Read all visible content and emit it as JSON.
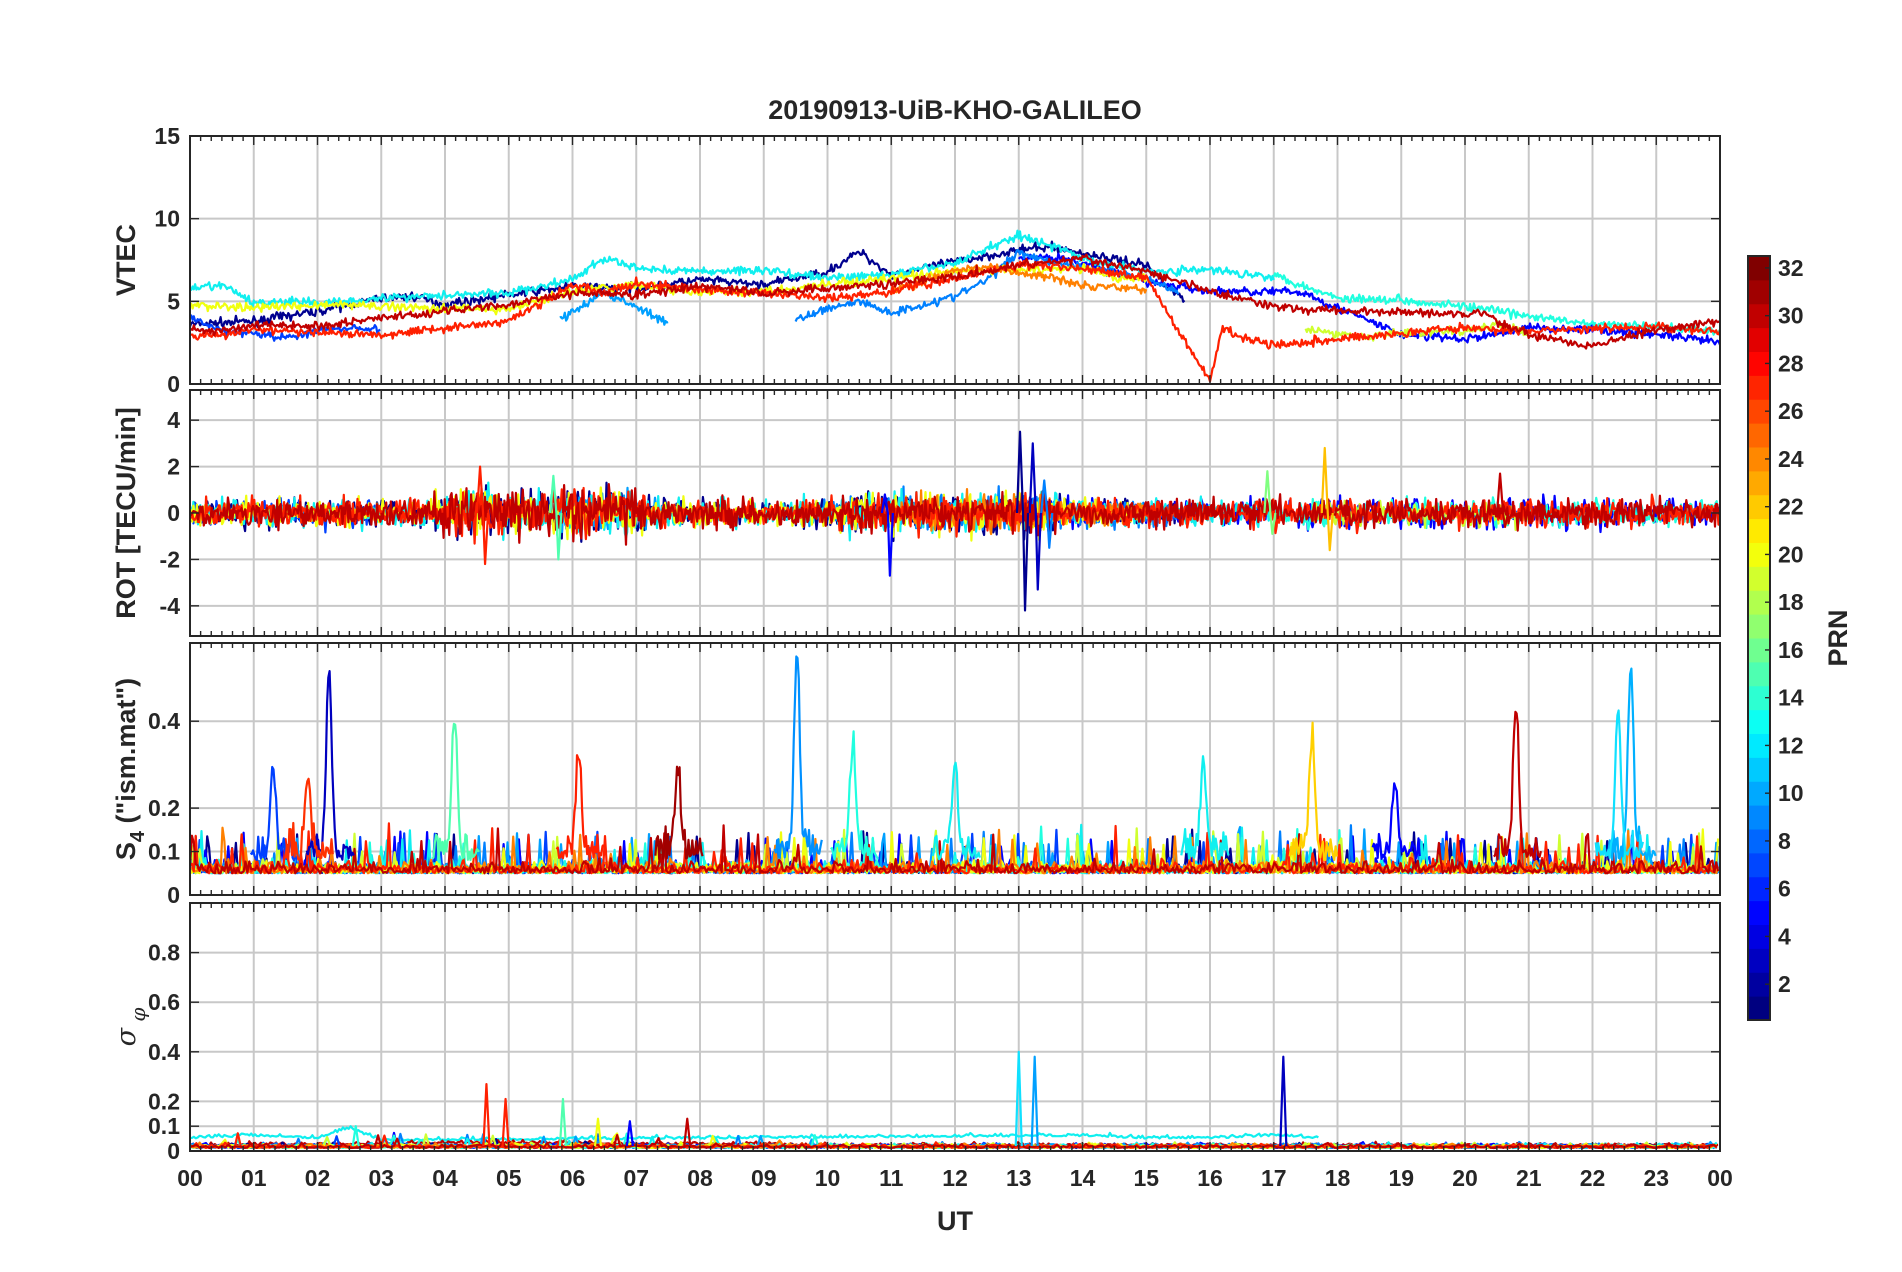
{
  "chart_data": {
    "type": "line",
    "title": "20190913-UiB-KHO-GALILEO",
    "xlabel": "UT",
    "x_ticks": [
      "00",
      "01",
      "02",
      "03",
      "04",
      "05",
      "06",
      "07",
      "08",
      "09",
      "10",
      "11",
      "12",
      "13",
      "14",
      "15",
      "16",
      "17",
      "18",
      "19",
      "20",
      "21",
      "22",
      "23",
      "00"
    ],
    "xlim_hours": [
      0,
      24
    ],
    "grid": true,
    "colorbar": {
      "label": "PRN",
      "colormap": "jet",
      "range": [
        1,
        32
      ],
      "ticks": [
        "2",
        "4",
        "6",
        "8",
        "10",
        "12",
        "14",
        "16",
        "18",
        "20",
        "22",
        "24",
        "26",
        "28",
        "30",
        "32"
      ],
      "placement": "right"
    },
    "panels": [
      {
        "id": "vtec",
        "ylabel": "VTEC",
        "ylim": [
          0,
          15
        ],
        "yticks": [
          0,
          5,
          10,
          15
        ],
        "ytick_labels": [
          "0",
          "5",
          "10",
          "15"
        ],
        "series": [
          {
            "prn": 2,
            "color": "#00008f",
            "x": [
              0,
              1,
              2,
              3,
              3.5,
              4,
              5,
              6,
              7,
              8,
              9,
              10,
              10.5,
              11,
              12,
              13,
              13.5,
              14,
              15,
              15.6
            ],
            "y": [
              3.6,
              3.8,
              4.4,
              5.2,
              5.3,
              4.8,
              5.4,
              5.9,
              5.8,
              6.3,
              6.0,
              6.8,
              8.0,
              6.6,
              7.4,
              8.1,
              8.3,
              7.9,
              7.2,
              5.0
            ]
          },
          {
            "prn": 3,
            "color": "#0000ff",
            "x": [
              13,
              13.5,
              14,
              15,
              16,
              17,
              17.5,
              18,
              19,
              20,
              21,
              22,
              23,
              24
            ],
            "y": [
              7.6,
              7.7,
              7.3,
              6.2,
              5.6,
              5.6,
              5.5,
              4.6,
              3.0,
              2.7,
              3.4,
              3.3,
              3.0,
              2.5
            ]
          },
          {
            "prn": 5,
            "color": "#0040ff",
            "x": [
              0,
              0.5,
              1,
              1.5,
              2,
              2.5,
              3
            ],
            "y": [
              4.0,
              3.2,
              3.1,
              2.8,
              3.2,
              3.4,
              3.3
            ]
          },
          {
            "prn": 8,
            "color": "#0080ff",
            "x": [
              9.5,
              10,
              10.5,
              11,
              11.5,
              12,
              12.5,
              13,
              13.5,
              14,
              15,
              15.5
            ],
            "y": [
              3.8,
              4.6,
              5.0,
              4.3,
              4.8,
              5.3,
              6.3,
              8.0,
              7.4,
              7.1,
              6.4,
              5.6
            ]
          },
          {
            "prn": 9,
            "color": "#00a0ff",
            "x": [
              5.8,
              6.5,
              7,
              7.5
            ],
            "y": [
              3.9,
              5.5,
              4.7,
              3.6
            ]
          },
          {
            "prn": 12,
            "color": "#10efef",
            "x": [
              0,
              0.5,
              1,
              1.5,
              2,
              3,
              4,
              5,
              6,
              6.5,
              7,
              8,
              9,
              10,
              11,
              12,
              12.5,
              13,
              13.5,
              14,
              15,
              16,
              17
            ],
            "y": [
              5.7,
              6.0,
              4.9,
              5.0,
              4.9,
              5.2,
              5.4,
              5.5,
              6.3,
              7.6,
              7.0,
              6.8,
              6.9,
              6.4,
              6.6,
              7.3,
              8.2,
              9.0,
              8.4,
              7.6,
              6.8,
              6.9,
              6.5
            ]
          },
          {
            "prn": 13,
            "color": "#20ffdf",
            "x": [
              17,
              17.5,
              18,
              19,
              20,
              21,
              22,
              23,
              24
            ],
            "y": [
              6.6,
              5.9,
              5.2,
              5.1,
              4.7,
              4.1,
              3.6,
              3.5,
              3.2
            ]
          },
          {
            "prn": 19,
            "color": "#cfff30",
            "x": [
              17.5,
              18,
              18.5,
              19,
              20,
              20.5,
              21
            ],
            "y": [
              3.4,
              3.0,
              2.9,
              3.1,
              3.2,
              3.6,
              3.0
            ]
          },
          {
            "prn": 20,
            "color": "#f0ff0f",
            "x": [
              0,
              1,
              2,
              3,
              4,
              5,
              6,
              7,
              8,
              9,
              10,
              11,
              12,
              13,
              14,
              14.5,
              15
            ],
            "y": [
              4.8,
              4.6,
              4.8,
              4.7,
              4.6,
              4.5,
              5.6,
              6.0,
              5.5,
              5.6,
              6.0,
              6.4,
              6.8,
              6.9,
              7.0,
              6.4,
              6.4
            ]
          },
          {
            "prn": 24,
            "color": "#ff8000",
            "x": [
              11,
              11.5,
              12,
              12.5,
              13,
              13.5,
              14,
              14.5,
              15
            ],
            "y": [
              5.6,
              6.2,
              6.9,
              7.1,
              6.7,
              6.5,
              6.0,
              5.9,
              5.7
            ]
          },
          {
            "prn": 27,
            "color": "#ff2000",
            "x": [
              0,
              0.5,
              1,
              2,
              3,
              4,
              5,
              6,
              6.5,
              7,
              8,
              9,
              10,
              11,
              12,
              13,
              14,
              15,
              16,
              16.2,
              16.5,
              17,
              18,
              19,
              20,
              21,
              22,
              23,
              24
            ],
            "y": [
              3.0,
              2.9,
              3.3,
              3.1,
              3.0,
              3.4,
              3.8,
              6.0,
              5.5,
              6.1,
              5.7,
              5.5,
              5.2,
              5.6,
              6.4,
              7.2,
              7.0,
              6.4,
              0.2,
              3.5,
              2.8,
              2.4,
              2.7,
              3.1,
              3.4,
              3.2,
              3.3,
              3.5,
              3.1
            ]
          },
          {
            "prn": 30,
            "color": "#c00000",
            "x": [
              0,
              0.5,
              1,
              2,
              3,
              4,
              5,
              6,
              7,
              8,
              9,
              10,
              11,
              12,
              13,
              14,
              15,
              16,
              17,
              18,
              19,
              20,
              20.3,
              20.5,
              21,
              21.5,
              22,
              23,
              24
            ],
            "y": [
              3.4,
              3.2,
              3.6,
              3.5,
              4.0,
              4.4,
              4.8,
              5.5,
              5.4,
              5.9,
              5.5,
              5.8,
              6.1,
              6.5,
              7.2,
              7.6,
              6.8,
              5.6,
              4.7,
              4.4,
              4.4,
              4.2,
              4.4,
              3.8,
              3.0,
              2.6,
              2.3,
              3.3,
              3.8
            ]
          }
        ]
      },
      {
        "id": "rot",
        "ylabel": "ROT [TECU/min]",
        "ylim": [
          -5.3,
          5.3
        ],
        "yticks": [
          -4,
          -2,
          0,
          2,
          4
        ],
        "ytick_labels": [
          "-4",
          "-2",
          "0",
          "2",
          "4"
        ],
        "spikes": [
          {
            "prn": 1,
            "color": "#00008f",
            "x": 13.02,
            "min": -4.2,
            "max": 3.5
          },
          {
            "prn": 2,
            "color": "#0000c0",
            "x": 13.22,
            "min": -3.3,
            "max": 3.0
          },
          {
            "prn": 3,
            "color": "#0000ff",
            "x": 10.9,
            "min": -2.7,
            "max": 0.8
          },
          {
            "prn": 8,
            "color": "#0080ff",
            "x": 13.4,
            "min": -1.5,
            "max": 1.4
          },
          {
            "prn": 27,
            "color": "#ff2000",
            "x": 4.55,
            "min": -2.2,
            "max": 2.0
          },
          {
            "prn": 22,
            "color": "#ffc000",
            "x": 17.8,
            "min": -1.6,
            "max": 2.8
          },
          {
            "prn": 16,
            "color": "#80ff80",
            "x": 16.9,
            "min": -0.9,
            "max": 1.8
          },
          {
            "prn": 30,
            "color": "#c00000",
            "x": 20.55,
            "min": -0.6,
            "max": 1.7
          },
          {
            "prn": 15,
            "color": "#50ffaf",
            "x": 5.7,
            "min": -2.0,
            "max": 1.6
          }
        ]
      },
      {
        "id": "s4",
        "ylabel": "S4 (\"ism.mat\")",
        "ylim": [
          0,
          0.58
        ],
        "yticks": [
          0,
          0.1,
          0.2,
          0.4
        ],
        "ytick_labels": [
          "0",
          "0.1",
          "0.2",
          "0.4"
        ],
        "spikes": [
          {
            "prn": 2,
            "color": "#0000bf",
            "x": 2.18,
            "max": 0.51
          },
          {
            "prn": 10,
            "color": "#0090ff",
            "x": 9.52,
            "max": 0.55
          },
          {
            "prn": 15,
            "color": "#50ffaf",
            "x": 4.15,
            "max": 0.4
          },
          {
            "prn": 30,
            "color": "#c00000",
            "x": 20.8,
            "max": 0.42
          },
          {
            "prn": 11,
            "color": "#00b0ff",
            "x": 22.6,
            "max": 0.5
          },
          {
            "prn": 12,
            "color": "#10e0ff",
            "x": 22.4,
            "max": 0.42
          },
          {
            "prn": 21,
            "color": "#ffd000",
            "x": 17.6,
            "max": 0.34
          },
          {
            "prn": 27,
            "color": "#ff2000",
            "x": 6.1,
            "max": 0.31
          },
          {
            "prn": 13,
            "color": "#20ffdf",
            "x": 10.4,
            "max": 0.34
          },
          {
            "prn": 31,
            "color": "#a00000",
            "x": 7.65,
            "max": 0.28
          },
          {
            "prn": 6,
            "color": "#0040ff",
            "x": 1.3,
            "max": 0.29
          },
          {
            "prn": 12,
            "color": "#10efef",
            "x": 12.0,
            "max": 0.3
          },
          {
            "prn": 12,
            "color": "#10efef",
            "x": 15.9,
            "max": 0.29
          },
          {
            "prn": 28,
            "color": "#ff3000",
            "x": 1.85,
            "max": 0.26
          },
          {
            "prn": 3,
            "color": "#0000ff",
            "x": 18.9,
            "max": 0.24
          }
        ]
      },
      {
        "id": "sigma_phi",
        "ylabel": "σφ",
        "ylim": [
          0,
          1.0
        ],
        "yticks": [
          0,
          0.1,
          0.2,
          0.4,
          0.6,
          0.8
        ],
        "ytick_labels": [
          "0",
          "0.1",
          "0.2",
          "0.4",
          "0.6",
          "0.8"
        ],
        "spikes": [
          {
            "prn": 12,
            "color": "#10e0ff",
            "x": 13.0,
            "max": 0.4
          },
          {
            "prn": 9,
            "color": "#00a0ff",
            "x": 13.25,
            "max": 0.38
          },
          {
            "prn": 2,
            "color": "#0000bf",
            "x": 17.15,
            "max": 0.38
          },
          {
            "prn": 27,
            "color": "#ff2000",
            "x": 4.65,
            "max": 0.27
          },
          {
            "prn": 27,
            "color": "#ff2000",
            "x": 4.95,
            "max": 0.21
          },
          {
            "prn": 15,
            "color": "#50ffaf",
            "x": 5.85,
            "max": 0.21
          },
          {
            "prn": 30,
            "color": "#c00000",
            "x": 7.8,
            "max": 0.13
          },
          {
            "prn": 20,
            "color": "#f0ff0f",
            "x": 6.4,
            "max": 0.13
          },
          {
            "prn": 3,
            "color": "#0000ff",
            "x": 6.9,
            "max": 0.12
          },
          {
            "prn": 13,
            "color": "#20ffdf",
            "x": 2.6,
            "max": 0.1
          }
        ],
        "baseline": [
          {
            "prn": 12,
            "color": "#10efef",
            "x": [
              0,
              1,
              2,
              2.5,
              3,
              14,
              15,
              16,
              17,
              17.7
            ],
            "y": [
              0.05,
              0.06,
              0.05,
              0.09,
              0.04,
              0.06,
              0.05,
              0.05,
              0.06,
              0.05
            ]
          },
          {
            "prn": 30,
            "color": "#c00000",
            "x": [
              0,
              5,
              10,
              16,
              20,
              24
            ],
            "y": [
              0.02,
              0.03,
              0.02,
              0.02,
              0.02,
              0.02
            ]
          }
        ]
      }
    ]
  }
}
